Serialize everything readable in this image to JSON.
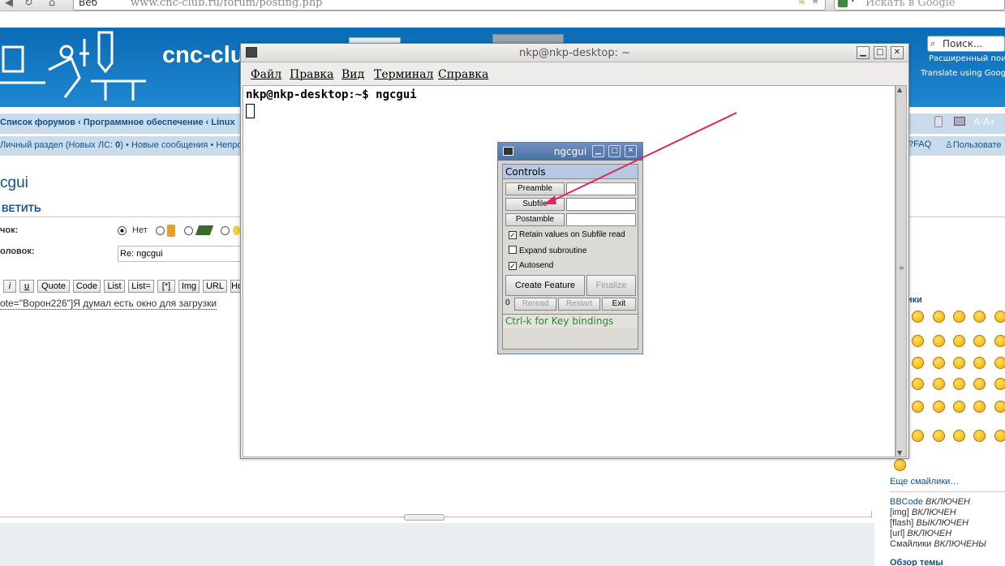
{
  "browser": {
    "back_label": "Веб",
    "url": "www.cnc-club.ru/forum/posting.php",
    "search_placeholder": "Искать в Google"
  },
  "site": {
    "title": "cnc-club",
    "search_placeholder": "Поиск...",
    "advanced_search": "Расширенный поис",
    "translate": "Translate using Google"
  },
  "nav": {
    "breadcrumb_1": "Список форумов",
    "breadcrumb_sep": " ‹ ",
    "breadcrumb_2": "Программное обеспечение",
    "breadcrumb_3": "Linux",
    "personal": "Личный раздел (Новых ЛС: ",
    "personal_count": "0",
    "personal_close": ")",
    "new_messages": "Новые сообщения",
    "unread": "Непро",
    "faq": "FAQ",
    "users": "Пользовате",
    "font_size": "A-A+"
  },
  "posting": {
    "topic_title": "cgui",
    "reply_label": "ВЕТИТЬ",
    "icon_label": "чок:",
    "icon_none": "Нет",
    "subject_label": "оловок:",
    "subject_value": "Re: ngcgui",
    "bb_buttons": [
      "i",
      "u",
      "Quote",
      "Code",
      "List",
      "List=",
      "[*]",
      "Img",
      "URL",
      "Норм"
    ],
    "message_text": "ote=\"Ворон226\"]Я думал есть окно для загрузки"
  },
  "side": {
    "smilies_heading": "айлики",
    "more_smilies": "Еще смайлики…",
    "bbcode": "BBCode",
    "bbcode_state": "ВКЛЮЧЕН",
    "img": "[img]",
    "img_state": "ВКЛЮЧЕН",
    "flash": "[flash]",
    "flash_state": "ВЫКЛЮЧЕН",
    "url": "[url]",
    "url_state": "ВКЛЮЧЕН",
    "smilies": "Смайлики",
    "smilies_state": "ВКЛЮЧЕНЫ",
    "topic_review": "Обзор темы"
  },
  "terminal": {
    "title": "nkp@nkp-desktop: ~",
    "menu": [
      "Файл",
      "Правка",
      "Вид",
      "Терминал",
      "Справка"
    ],
    "prompt": "nkp@nkp-desktop:~$ ngcgui"
  },
  "ngcgui": {
    "title": "ngcgui",
    "controls": "Controls",
    "preamble": "Preamble",
    "subfile": "Subfile",
    "postamble": "Postamble",
    "retain": "Retain values on Subfile read",
    "expand": "Expand subroutine",
    "autosend": "Autosend",
    "create_feature": "Create Feature",
    "finalize": "Finalize",
    "count": "0",
    "reread": "Reread",
    "restart": "Restart",
    "exit": "Exit",
    "status": "Ctrl-k for Key bindings",
    "checks": {
      "retain": true,
      "expand": false,
      "autosend": true
    }
  },
  "colors": {
    "site_header": "#1278c4",
    "annotation_arrow": "#e0245e",
    "status_text": "#2a8a2a"
  }
}
